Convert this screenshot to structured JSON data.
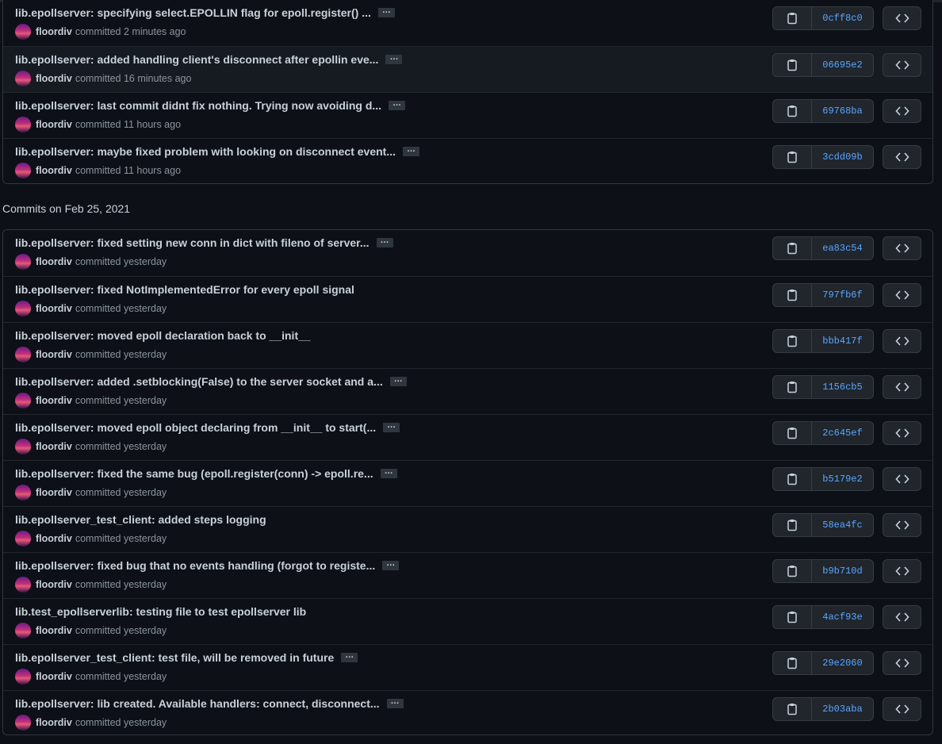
{
  "groups": [
    {
      "heading": "",
      "commits": [
        {
          "message": "lib.epollserver: specifying select.EPOLLIN flag for epoll.register() ...",
          "author": "floordiv",
          "verb": "committed",
          "time": "2 minutes ago",
          "sha": "0cff8c0",
          "more": true
        },
        {
          "message": "lib.epollserver: added handling client's disconnect after epollin eve...",
          "author": "floordiv",
          "verb": "committed",
          "time": "16 minutes ago",
          "sha": "06695e2",
          "more": true
        },
        {
          "message": "lib.epollserver: last commit didnt fix nothing. Trying now avoiding d...",
          "author": "floordiv",
          "verb": "committed",
          "time": "11 hours ago",
          "sha": "69768ba",
          "more": true
        },
        {
          "message": "lib.epollserver: maybe fixed problem with looking on disconnect event...",
          "author": "floordiv",
          "verb": "committed",
          "time": "11 hours ago",
          "sha": "3cdd09b",
          "more": true
        }
      ]
    },
    {
      "heading": "Commits on Feb 25, 2021",
      "commits": [
        {
          "message": "lib.epollserver: fixed setting new conn in dict with fileno of server...",
          "author": "floordiv",
          "verb": "committed",
          "time": "yesterday",
          "sha": "ea83c54",
          "more": true
        },
        {
          "message": "lib.epollserver: fixed NotImplementedError for every epoll signal",
          "author": "floordiv",
          "verb": "committed",
          "time": "yesterday",
          "sha": "797fb6f",
          "more": false
        },
        {
          "message": "lib.epollserver: moved epoll declaration back to __init__",
          "author": "floordiv",
          "verb": "committed",
          "time": "yesterday",
          "sha": "bbb417f",
          "more": false
        },
        {
          "message": "lib.epollserver: added .setblocking(False) to the server socket and a...",
          "author": "floordiv",
          "verb": "committed",
          "time": "yesterday",
          "sha": "1156cb5",
          "more": true
        },
        {
          "message": "lib.epollserver: moved epoll object declaring from __init__ to start(...",
          "author": "floordiv",
          "verb": "committed",
          "time": "yesterday",
          "sha": "2c645ef",
          "more": true
        },
        {
          "message": "lib.epollserver: fixed the same bug (epoll.register(conn) -> epoll.re...",
          "author": "floordiv",
          "verb": "committed",
          "time": "yesterday",
          "sha": "b5179e2",
          "more": true
        },
        {
          "message": "lib.epollserver_test_client: added steps logging",
          "author": "floordiv",
          "verb": "committed",
          "time": "yesterday",
          "sha": "58ea4fc",
          "more": false
        },
        {
          "message": "lib.epollserver: fixed bug that no events handling (forgot to registe...",
          "author": "floordiv",
          "verb": "committed",
          "time": "yesterday",
          "sha": "b9b710d",
          "more": true
        },
        {
          "message": "lib.test_epollserverlib: testing file to test epollserver lib",
          "author": "floordiv",
          "verb": "committed",
          "time": "yesterday",
          "sha": "4acf93e",
          "more": false
        },
        {
          "message": "lib.epollserver_test_client: test file, will be removed in future",
          "author": "floordiv",
          "verb": "committed",
          "time": "yesterday",
          "sha": "29e2060",
          "more": true
        },
        {
          "message": "lib.epollserver: lib created. Available handlers: connect, disconnect...",
          "author": "floordiv",
          "verb": "committed",
          "time": "yesterday",
          "sha": "2b03aba",
          "more": true
        }
      ]
    }
  ],
  "ellipsis_label": "…",
  "icons": {
    "copy": "clipboard-icon",
    "browse": "code-icon"
  },
  "colors": {
    "background": "#0d1117",
    "border": "#30363d",
    "sha_link": "#58a6ff",
    "muted": "#8b949e"
  }
}
